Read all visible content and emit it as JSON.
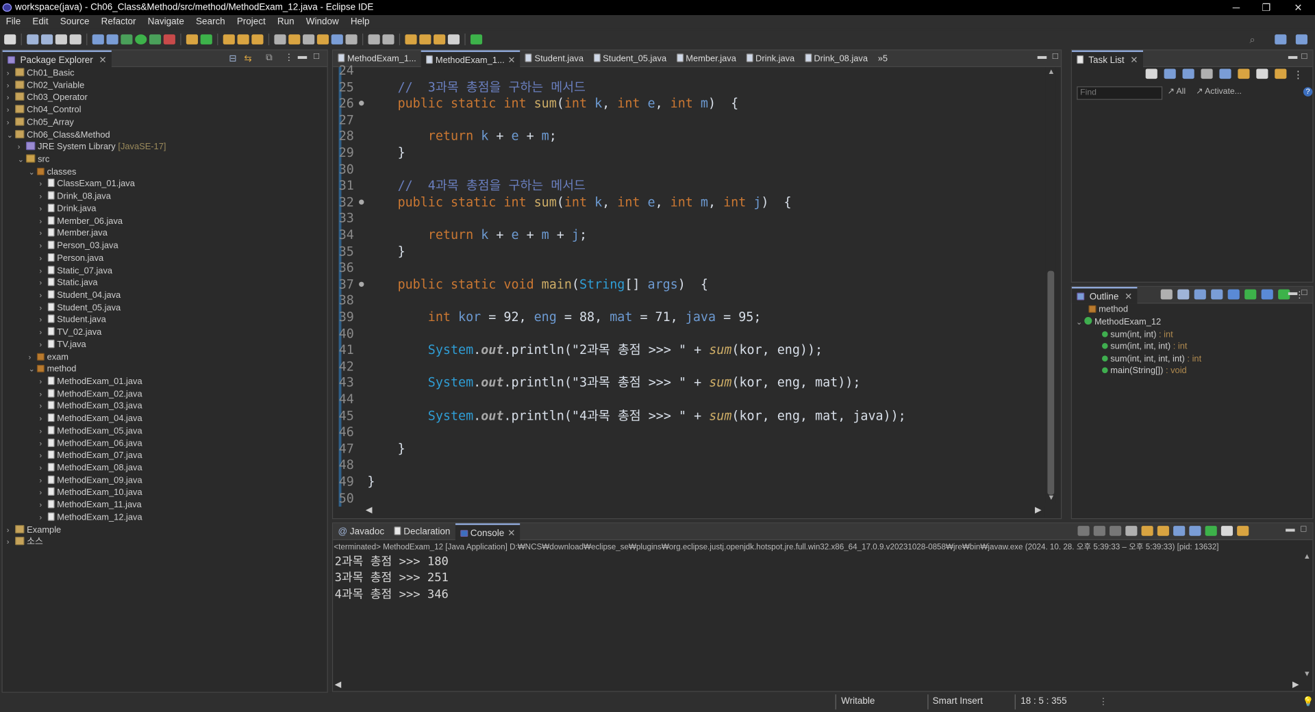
{
  "window": {
    "title": "workspace(java) - Ch06_Class&Method/src/method/MethodExam_12.java - Eclipse IDE"
  },
  "menu": [
    "File",
    "Edit",
    "Source",
    "Refactor",
    "Navigate",
    "Search",
    "Project",
    "Run",
    "Window",
    "Help"
  ],
  "package_explorer": {
    "title": "Package Explorer",
    "projects_top": [
      "Ch01_Basic",
      "Ch02_Variable",
      "Ch03_Operator",
      "Ch04_Control",
      "Ch05_Array",
      "Ch06_Class&Method"
    ],
    "jre": "JRE System Library",
    "jre_version": "[JavaSE-17]",
    "src": "src",
    "classes_pkg": "classes",
    "classes_files": [
      "ClassExam_01.java",
      "Drink_08.java",
      "Drink.java",
      "Member_06.java",
      "Member.java",
      "Person_03.java",
      "Person.java",
      "Static_07.java",
      "Static.java",
      "Student_04.java",
      "Student_05.java",
      "Student.java",
      "TV_02.java",
      "TV.java"
    ],
    "exam_pkg": "exam",
    "method_pkg": "method",
    "method_files": [
      "MethodExam_01.java",
      "MethodExam_02.java",
      "MethodExam_03.java",
      "MethodExam_04.java",
      "MethodExam_05.java",
      "MethodExam_06.java",
      "MethodExam_07.java",
      "MethodExam_08.java",
      "MethodExam_09.java",
      "MethodExam_10.java",
      "MethodExam_11.java",
      "MethodExam_12.java"
    ],
    "projects_bottom": [
      "Example",
      "소스"
    ]
  },
  "editor_tabs": [
    "MethodExam_1...",
    "MethodExam_1...",
    "Student.java",
    "Student_05.java",
    "Member.java",
    "Drink.java",
    "Drink_08.java",
    "»5"
  ],
  "line_numbers": [
    "24",
    "25",
    "26",
    "27",
    "28",
    "29",
    "30",
    "31",
    "32",
    "33",
    "34",
    "35",
    "36",
    "37",
    "38",
    "39",
    "40",
    "41",
    "42",
    "43",
    "44",
    "45",
    "46",
    "47",
    "48",
    "49",
    "50"
  ],
  "code": {
    "c25": "//  3과목 총점을 구하는 메서드",
    "c31": "//  4과목 총점을 구하는 메서드",
    "kw_public": "public",
    "kw_static": "static",
    "kw_int": "int",
    "kw_void": "void",
    "kw_return": "return",
    "fn_sum": "sum",
    "fn_main": "main",
    "t_string": "String",
    "s_2": "\"2과목 총점 >>> \"",
    "s_3": "\"3과목 총점 >>> \"",
    "s_4": "\"4과목 총점 >>> \""
  },
  "task_list": {
    "title": "Task List",
    "find_placeholder": "Find",
    "all": "All",
    "activate": "Activate..."
  },
  "outline": {
    "title": "Outline",
    "package": "method",
    "class": "MethodExam_12",
    "members": [
      {
        "name": "sum(int, int)",
        "type": " : int"
      },
      {
        "name": "sum(int, int, int)",
        "type": " : int"
      },
      {
        "name": "sum(int, int, int, int)",
        "type": " : int"
      },
      {
        "name": "main(String[])",
        "type": " : void"
      }
    ]
  },
  "console": {
    "tabs": [
      "Javadoc",
      "Declaration",
      "Console"
    ],
    "header": "<terminated> MethodExam_12 [Java Application] D:₩NCS₩download₩eclipse_se₩plugins₩org.eclipse.justj.openjdk.hotspot.jre.full.win32.x86_64_17.0.9.v20231028-0858₩jre₩bin₩javaw.exe  (2024. 10. 28. 오후 5:39:33 – 오후 5:39:33) [pid: 13632]",
    "lines": [
      "2과목 총점 >>> 180",
      "3과목 총점 >>> 251",
      "4과목 총점 >>> 346"
    ]
  },
  "status": {
    "writable": "Writable",
    "insert": "Smart Insert",
    "position": "18 : 5 : 355"
  }
}
